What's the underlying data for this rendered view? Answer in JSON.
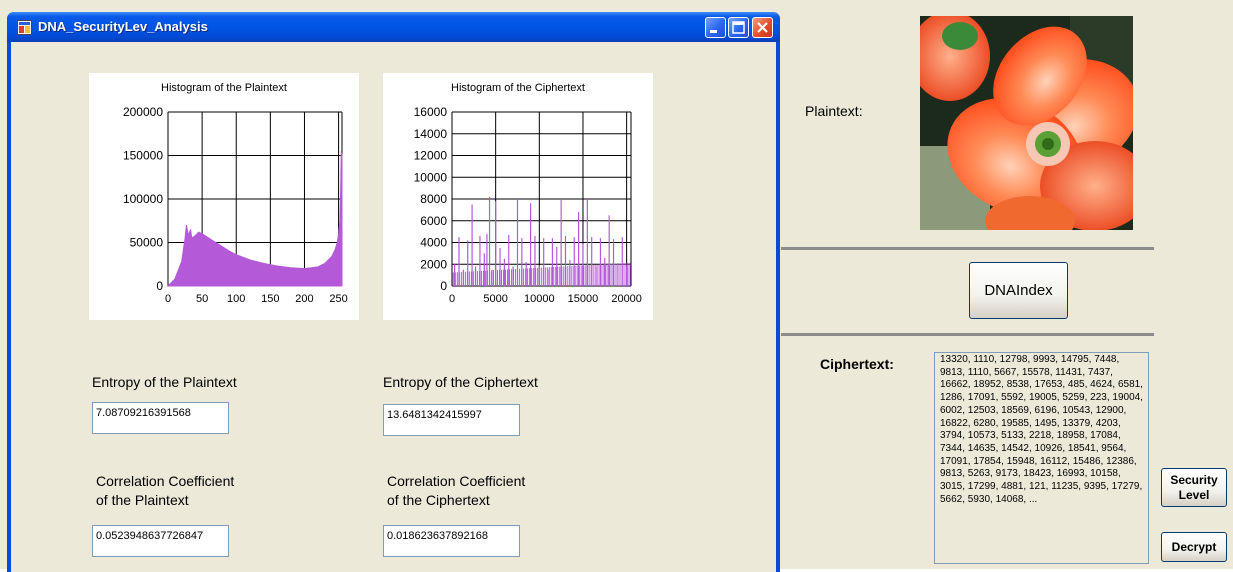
{
  "window": {
    "title": "DNA_SecurityLev_Analysis"
  },
  "histogram_plain": {
    "title": "Histogram of the Plaintext",
    "y_ticks": [
      "200000",
      "150000",
      "100000",
      "50000",
      "0"
    ],
    "x_ticks": [
      "0",
      "50",
      "100",
      "150",
      "200",
      "250"
    ]
  },
  "histogram_cipher": {
    "title": "Histogram of the Ciphertext",
    "y_ticks": [
      "16000",
      "14000",
      "12000",
      "10000",
      "8000",
      "6000",
      "4000",
      "2000",
      "0"
    ],
    "x_ticks": [
      "0",
      "5000",
      "10000",
      "15000",
      "20000"
    ]
  },
  "chart_data": [
    {
      "type": "area",
      "title": "Histogram of the Plaintext",
      "xlim": [
        0,
        255
      ],
      "ylim": [
        0,
        200000
      ],
      "x": [
        0,
        10,
        15,
        20,
        25,
        27,
        30,
        33,
        35,
        40,
        45,
        50,
        60,
        70,
        80,
        90,
        100,
        120,
        140,
        160,
        180,
        200,
        220,
        230,
        240,
        245,
        248,
        250,
        252,
        253,
        254,
        255
      ],
      "y": [
        0,
        8000,
        18000,
        28000,
        55000,
        70000,
        58000,
        65000,
        55000,
        58000,
        62000,
        60000,
        55000,
        50000,
        45000,
        40000,
        36000,
        30000,
        26000,
        23000,
        21000,
        20000,
        22000,
        26000,
        34000,
        42000,
        50000,
        60000,
        75000,
        110000,
        155000,
        150000
      ]
    },
    {
      "type": "bar",
      "title": "Histogram of the Ciphertext",
      "xlim": [
        0,
        20500
      ],
      "ylim": [
        0,
        16000
      ],
      "x": [
        300,
        800,
        1300,
        1800,
        2300,
        2700,
        3200,
        3700,
        4000,
        4300,
        4700,
        5000,
        5500,
        6000,
        6500,
        7000,
        7500,
        8000,
        8500,
        9000,
        9500,
        10000,
        10500,
        11000,
        11500,
        12000,
        12500,
        13000,
        13500,
        14000,
        14500,
        15000,
        15500,
        16000,
        16500,
        17000,
        17500,
        18000,
        18500,
        19000,
        19500,
        20000
      ],
      "y": [
        2000,
        4500,
        1500,
        4200,
        7500,
        1800,
        4600,
        3000,
        4800,
        8200,
        1500,
        7800,
        3500,
        2500,
        4700,
        1800,
        8000,
        4400,
        2200,
        7600,
        4600,
        1900,
        4400,
        1500,
        4400,
        3600,
        7900,
        4600,
        2400,
        4500,
        6800,
        3900,
        8000,
        4500,
        1800,
        4400,
        2600,
        6500,
        4300,
        2100,
        4500,
        1900
      ]
    }
  ],
  "entropy_plain": {
    "label": "Entropy of the Plaintext",
    "value": "7.08709216391568"
  },
  "entropy_cipher": {
    "label": "Entropy of the Ciphertext",
    "value": "13.6481342415997"
  },
  "corr_plain": {
    "label_line1": "Correlation Coefficient",
    "label_line2": "of the Plaintext",
    "value": "0.0523948637726847"
  },
  "corr_cipher": {
    "label_line1": "Correlation Coefficient",
    "label_line2": "of the Ciphertext",
    "value": "0.018623637892168"
  },
  "right_panel": {
    "plaintext_label": "Plaintext:",
    "dna_index_button": "DNAIndex",
    "ciphertext_label": "Ciphertext:",
    "ciphertext_value": "13320, 1110, 12798, 9993, 14795, 7448, 9813, 1110, 5667, 15578, 11431, 7437, 16662, 18952, 8538, 17653, 485, 4624, 6581, 1286, 17091, 5592, 19005, 5259, 223, 19004, 6002, 12503, 18569, 6196, 10543, 12900, 16822, 6280, 19585, 1495, 13379, 4203, 3794, 10573, 5133, 2218, 18958, 17084, 7344, 14635, 14542, 10926, 18541, 9564, 17091, 17854, 15948, 16112, 15486, 12386, 9813, 5263, 9173, 18423, 16993, 10158, 3015, 17299, 4881, 121, 11235, 9395, 17279, 5662, 5930, 14068, ...",
    "security_level_line1": "Security",
    "security_level_line2": "Level",
    "decrypt_button": "Decrypt"
  },
  "colors": {
    "histogram_fill": "#b45ad8",
    "titlebar": "#0054e3",
    "window_bg": "#ece9d8"
  }
}
